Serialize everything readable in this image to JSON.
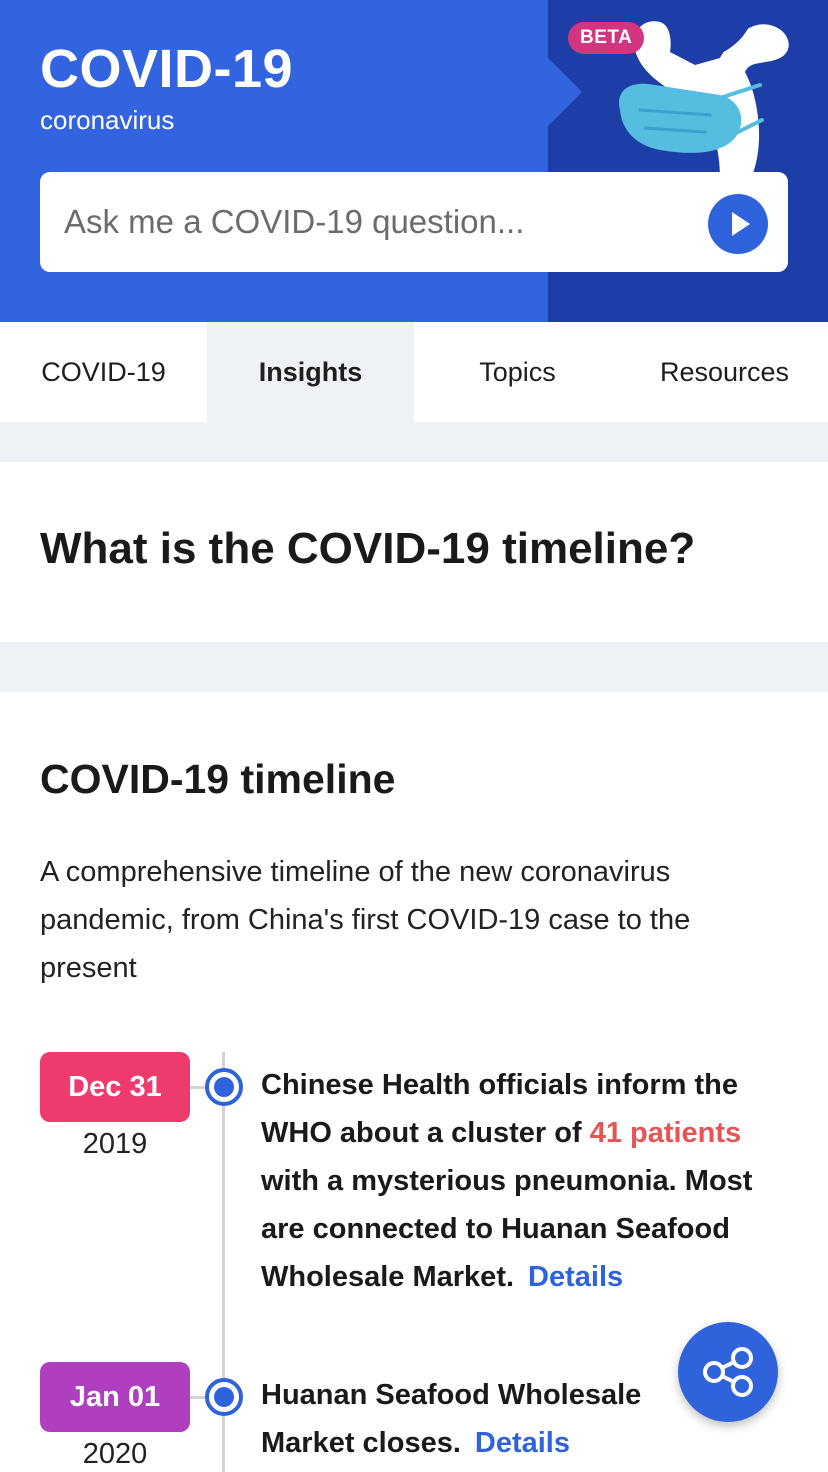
{
  "header": {
    "title": "COVID-19",
    "subtitle": "coronavirus",
    "badge": "BETA",
    "colors": {
      "primary": "#3264e0",
      "dark": "#1d3ea6",
      "badge": "#d2357f"
    }
  },
  "search": {
    "placeholder": "Ask me a COVID-19 question...",
    "value": ""
  },
  "tabs": [
    {
      "label": "COVID-19",
      "active": false
    },
    {
      "label": "Insights",
      "active": true
    },
    {
      "label": "Topics",
      "active": false
    },
    {
      "label": "Resources",
      "active": false
    }
  ],
  "question": "What is the COVID-19 timeline?",
  "timeline": {
    "title": "COVID-19 timeline",
    "description": "A comprehensive timeline of the new coronavirus pandemic, from China's first COVID-19 case to the present",
    "events": [
      {
        "date": "Dec 31",
        "year": "2019",
        "badge_color": "#ee3b6e",
        "text_before": "Chinese Health officials inform the WHO about a cluster of ",
        "highlight": "41 patients",
        "text_after": " with a mysterious pneumonia. Most are connected to Huanan Seafood Wholesale Market.",
        "link": "Details"
      },
      {
        "date": "Jan 01",
        "year": "2020",
        "badge_color": "#b03fc0",
        "text_before": "Huanan Seafood Wholesale Market closes.",
        "link": "Details"
      }
    ]
  },
  "icons": {
    "send": "play-arrow-icon",
    "share": "share-icon",
    "mascot": "mascot-rabbit-mask-icon"
  }
}
